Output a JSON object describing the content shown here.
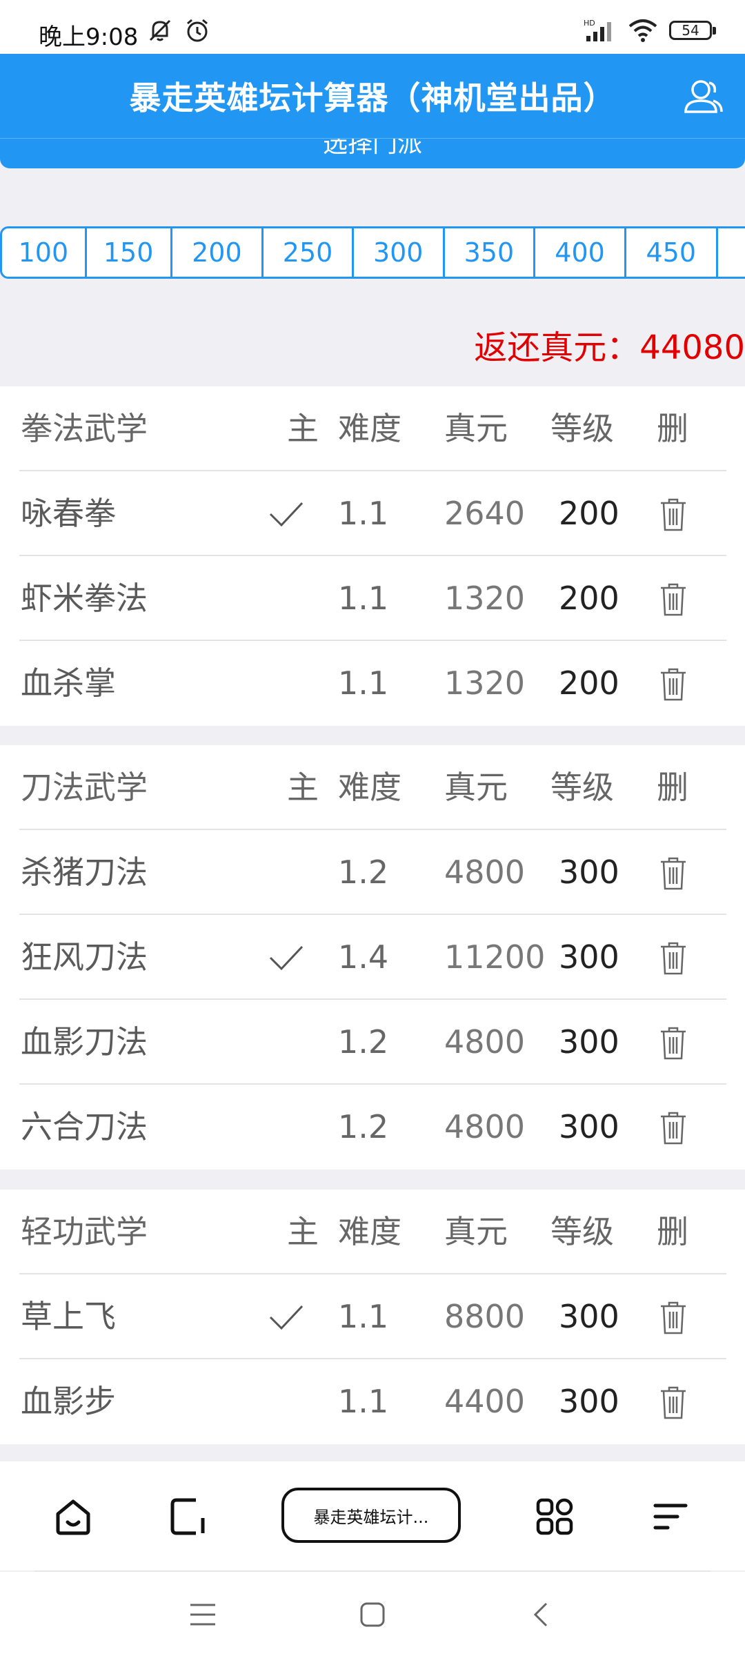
{
  "status": {
    "time": "晚上9:08",
    "battery": "54"
  },
  "header": {
    "title": "暴走英雄坛计算器（神机堂出品）",
    "sub_label": "选择门派"
  },
  "levels": [
    "100",
    "150",
    "200",
    "250",
    "300",
    "350",
    "400",
    "450",
    ""
  ],
  "refund": {
    "label": "返还真元：",
    "value": "44080"
  },
  "columns": {
    "main": "主",
    "difficulty": "难度",
    "zhenyuan": "真元",
    "level": "等级",
    "delete": "删"
  },
  "sections": [
    {
      "title": "拳法武学",
      "rows": [
        {
          "name": "咏春拳",
          "main": true,
          "difficulty": "1.1",
          "zhenyuan": "2640",
          "level": "200"
        },
        {
          "name": "虾米拳法",
          "main": false,
          "difficulty": "1.1",
          "zhenyuan": "1320",
          "level": "200"
        },
        {
          "name": "血杀掌",
          "main": false,
          "difficulty": "1.1",
          "zhenyuan": "1320",
          "level": "200"
        }
      ]
    },
    {
      "title": "刀法武学",
      "rows": [
        {
          "name": "杀猪刀法",
          "main": false,
          "difficulty": "1.2",
          "zhenyuan": "4800",
          "level": "300"
        },
        {
          "name": "狂风刀法",
          "main": true,
          "difficulty": "1.4",
          "zhenyuan": "11200",
          "level": "300"
        },
        {
          "name": "血影刀法",
          "main": false,
          "difficulty": "1.2",
          "zhenyuan": "4800",
          "level": "300"
        },
        {
          "name": "六合刀法",
          "main": false,
          "difficulty": "1.2",
          "zhenyuan": "4800",
          "level": "300"
        }
      ]
    },
    {
      "title": "轻功武学",
      "rows": [
        {
          "name": "草上飞",
          "main": true,
          "difficulty": "1.1",
          "zhenyuan": "8800",
          "level": "300"
        },
        {
          "name": "血影步",
          "main": false,
          "difficulty": "1.1",
          "zhenyuan": "4400",
          "level": "300"
        }
      ]
    }
  ],
  "browser": {
    "tab_label": "暴走英雄坛计..."
  },
  "colors": {
    "accent": "#2196f3",
    "refund": "#e00000"
  }
}
